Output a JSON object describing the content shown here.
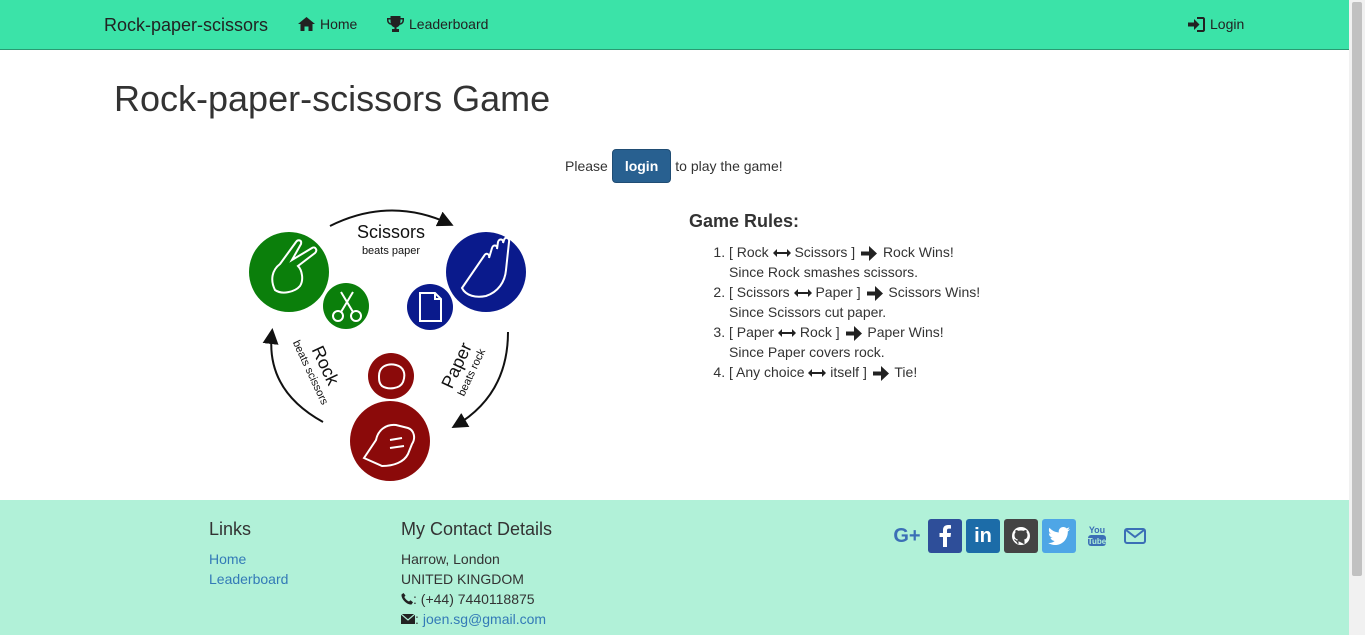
{
  "navbar": {
    "brand": "Rock-paper-scissors",
    "home_label": "Home",
    "leaderboard_label": "Leaderboard",
    "login_label": "Login",
    "home_icon": "home-icon",
    "trophy_icon": "trophy-icon",
    "login_icon": "sign-in-icon"
  },
  "main": {
    "title": "Rock-paper-scissors Game",
    "prompt_before": "Please",
    "login_button": "login",
    "prompt_after": "to play the game!",
    "diagram": {
      "scissors_label": "Scissors",
      "scissors_sub": "beats paper",
      "rock_label": "Rock",
      "rock_sub": "beats scissors",
      "paper_label": "Paper",
      "paper_sub": "beats rock"
    }
  },
  "rules": {
    "heading": "Game Rules:",
    "items": [
      {
        "left": "[ Rock",
        "right": "Scissors ]",
        "result": "Rock Wins!",
        "note": "Since Rock smashes scissors."
      },
      {
        "left": "[ Scissors",
        "right": "Paper ]",
        "result": "Scissors Wins!",
        "note": "Since Scissors cut paper."
      },
      {
        "left": "[ Paper",
        "right": "Rock ]",
        "result": "Paper Wins!",
        "note": "Since Paper covers rock."
      },
      {
        "left": "[ Any choice",
        "right": "itself ]",
        "result": "Tie!",
        "note": ""
      }
    ]
  },
  "footer": {
    "links_heading": "Links",
    "links": [
      "Home",
      "Leaderboard"
    ],
    "contact_heading": "My Contact Details",
    "address_line1": "Harrow, London",
    "address_line2": "UNITED KINGDOM",
    "phone": ": (+44) 7440118875",
    "email_prefix": ":",
    "email": "joen.sg@gmail.com",
    "social_icons": [
      "google-plus-icon",
      "facebook-icon",
      "linkedin-icon",
      "github-icon",
      "twitter-icon",
      "youtube-icon",
      "envelope-icon"
    ]
  },
  "colors": {
    "navbar_bg": "#3be3a8",
    "footer_bg": "#b1f1d8",
    "primary_button": "#286090",
    "link": "#337ab7",
    "scissors_green": "#0b7f0b",
    "paper_blue": "#0a1a8c",
    "rock_red": "#8b0a0a"
  }
}
